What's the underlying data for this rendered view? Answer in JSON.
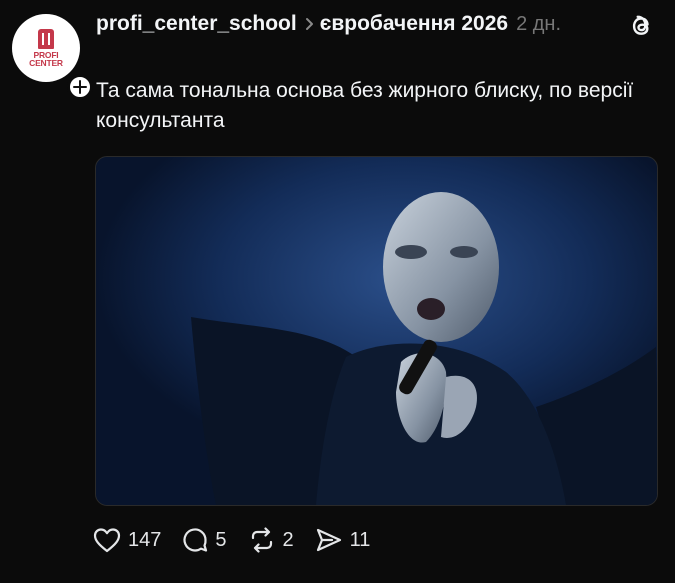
{
  "post": {
    "username": "profi_center_school",
    "topic": "євробачення 2026",
    "time": "2 дн.",
    "text": "Та сама тональна основа без жирного блиску, по версії консультанта"
  },
  "avatar": {
    "logo_line1": "PROFI",
    "logo_line2": "CENTER",
    "brand_color": "#c4384a"
  },
  "actions": {
    "likes": "147",
    "comments": "5",
    "reposts": "2",
    "shares": "11"
  },
  "icons": [
    "plus-icon",
    "chevron-right-icon",
    "threads-logo-icon",
    "heart-icon",
    "comment-icon",
    "repost-icon",
    "share-icon"
  ],
  "colors": {
    "background": "#0b0b0b",
    "text": "#f3f5f7",
    "muted": "#777777"
  }
}
